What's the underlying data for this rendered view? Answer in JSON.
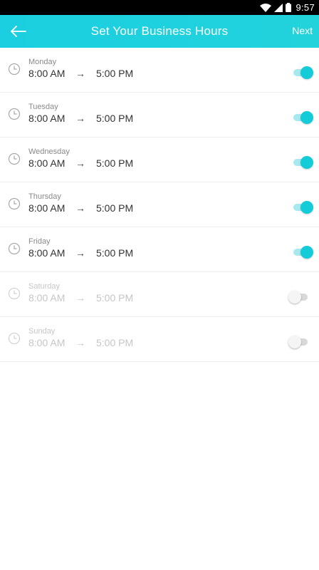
{
  "status_bar": {
    "time": "9:57",
    "icons": [
      "wifi-icon",
      "cell-signal-icon",
      "battery-icon"
    ]
  },
  "app_bar": {
    "title": "Set Your Business Hours",
    "back_icon": "arrow-left-icon",
    "next_label": "Next",
    "color": "#1bcfe0"
  },
  "days": [
    {
      "day": "Monday",
      "start": "8:00 AM",
      "arrow": "→",
      "end": "5:00 PM",
      "enabled": true
    },
    {
      "day": "Tuesday",
      "start": "8:00 AM",
      "arrow": "→",
      "end": "5:00 PM",
      "enabled": true
    },
    {
      "day": "Wednesday",
      "start": "8:00 AM",
      "arrow": "→",
      "end": "5:00 PM",
      "enabled": true
    },
    {
      "day": "Thursday",
      "start": "8:00 AM",
      "arrow": "→",
      "end": "5:00 PM",
      "enabled": true
    },
    {
      "day": "Friday",
      "start": "8:00 AM",
      "arrow": "→",
      "end": "5:00 PM",
      "enabled": true
    },
    {
      "day": "Saturday",
      "start": "8:00 AM",
      "arrow": "→",
      "end": "5:00 PM",
      "enabled": false
    },
    {
      "day": "Sunday",
      "start": "8:00 AM",
      "arrow": "→",
      "end": "5:00 PM",
      "enabled": false
    }
  ],
  "colors": {
    "toggle_on": "#14cbd8",
    "toggle_on_track": "#a6e9ee",
    "toggle_off_track": "#d9d9d9"
  }
}
